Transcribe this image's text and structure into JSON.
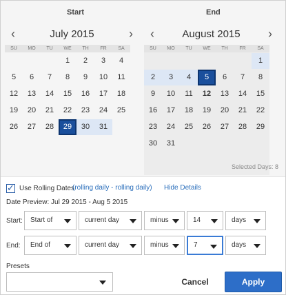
{
  "captions": {
    "start": "Start",
    "end": "End"
  },
  "start_calendar": {
    "month": "July 2015",
    "dow": [
      "SU",
      "MO",
      "TU",
      "WE",
      "TH",
      "FR",
      "SA"
    ],
    "weeks": [
      [
        "",
        "",
        "",
        "1",
        "2",
        "3",
        "4"
      ],
      [
        "5",
        "6",
        "7",
        "8",
        "9",
        "10",
        "11"
      ],
      [
        "12",
        "13",
        "14",
        "15",
        "16",
        "17",
        "18"
      ],
      [
        "19",
        "20",
        "21",
        "22",
        "23",
        "24",
        "25"
      ],
      [
        "26",
        "27",
        "28",
        "29",
        "30",
        "31",
        ""
      ]
    ],
    "selected": "29",
    "range": [
      "30",
      "31"
    ]
  },
  "end_calendar": {
    "month": "August 2015",
    "dow": [
      "SU",
      "MO",
      "TU",
      "WE",
      "TH",
      "FR",
      "SA"
    ],
    "weeks": [
      [
        "",
        "",
        "",
        "",
        "",
        "",
        "1"
      ],
      [
        "2",
        "3",
        "4",
        "5",
        "6",
        "7",
        "8"
      ],
      [
        "9",
        "10",
        "11",
        "12",
        "13",
        "14",
        "15"
      ],
      [
        "16",
        "17",
        "18",
        "19",
        "20",
        "21",
        "22"
      ],
      [
        "23",
        "24",
        "25",
        "26",
        "27",
        "28",
        "29"
      ],
      [
        "30",
        "31",
        "",
        "",
        "",
        "",
        ""
      ]
    ],
    "selected": "5",
    "range": [
      "1",
      "2",
      "3",
      "4"
    ],
    "today": "12"
  },
  "selected_days": "Selected Days: 8",
  "rolling": {
    "checked": true,
    "label": "Use Rolling Dates",
    "link": "(rolling daily - rolling daily)",
    "hide": "Hide Details"
  },
  "preview": "Date Preview: Jul 29 2015 - Aug 5 2015",
  "start_row": {
    "label": "Start:",
    "anchor": "Start of",
    "unit_ref": "current day",
    "op": "minus",
    "amount": "14",
    "unit": "days"
  },
  "end_row": {
    "label": "End:",
    "anchor": "End of",
    "unit_ref": "current day",
    "op": "minus",
    "amount": "7",
    "unit": "days"
  },
  "presets": {
    "label": "Presets",
    "value": ""
  },
  "buttons": {
    "cancel": "Cancel",
    "apply": "Apply"
  },
  "colors": {
    "accent": "#2d6ec8",
    "selected_day": "#1a4f9c",
    "range": "#dde7f5",
    "link": "#2a6ebb"
  }
}
